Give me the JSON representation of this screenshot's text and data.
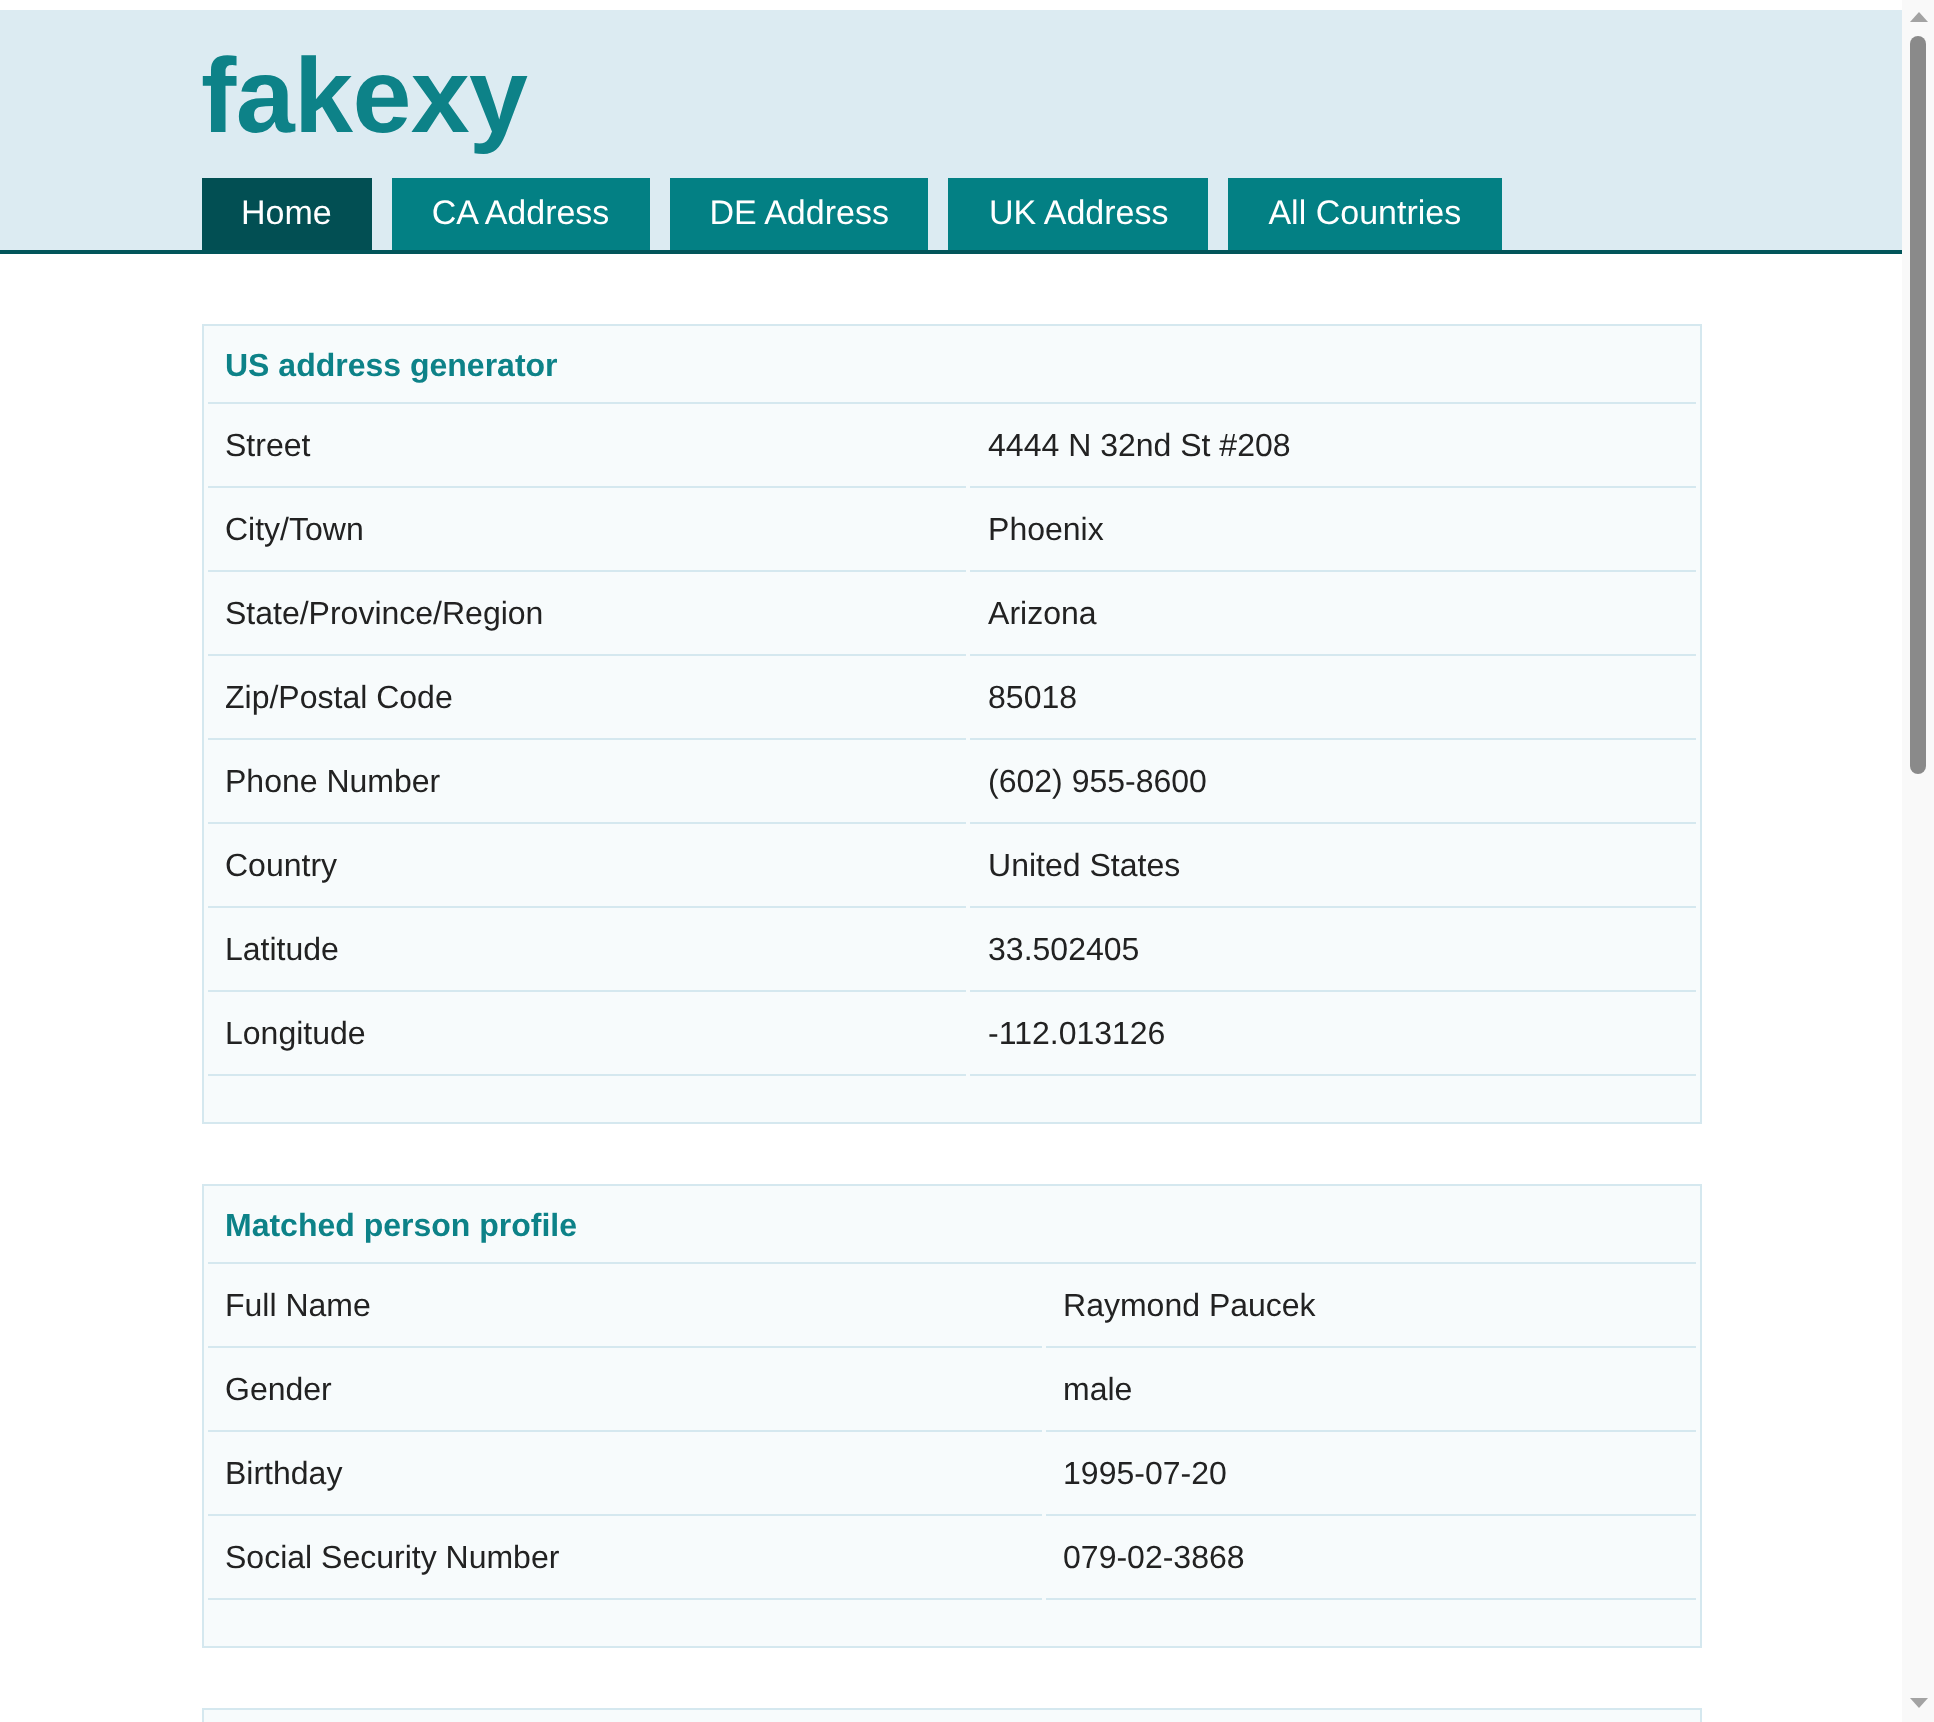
{
  "logo": "fakexy",
  "tabs": [
    {
      "label": "Home",
      "selected": true
    },
    {
      "label": "CA Address",
      "selected": false
    },
    {
      "label": "DE Address",
      "selected": false
    },
    {
      "label": "UK Address",
      "selected": false
    },
    {
      "label": "All Countries",
      "selected": false
    }
  ],
  "cards": [
    {
      "title": "US address generator",
      "rows": [
        {
          "label": "Street",
          "value": "4444 N 32nd St #208"
        },
        {
          "label": "City/Town",
          "value": "Phoenix"
        },
        {
          "label": "State/Province/Region",
          "value": "Arizona"
        },
        {
          "label": "Zip/Postal Code",
          "value": "85018"
        },
        {
          "label": "Phone Number",
          "value": "(602) 955-8600"
        },
        {
          "label": "Country",
          "value": "United States"
        },
        {
          "label": "Latitude",
          "value": "33.502405"
        },
        {
          "label": "Longitude",
          "value": "-112.013126"
        }
      ]
    },
    {
      "title": "Matched person profile",
      "rows": [
        {
          "label": "Full Name",
          "value": "Raymond Paucek"
        },
        {
          "label": "Gender",
          "value": "male"
        },
        {
          "label": "Birthday",
          "value": "1995-07-20"
        },
        {
          "label": "Social Security Number",
          "value": "079-02-3868"
        }
      ]
    }
  ]
}
